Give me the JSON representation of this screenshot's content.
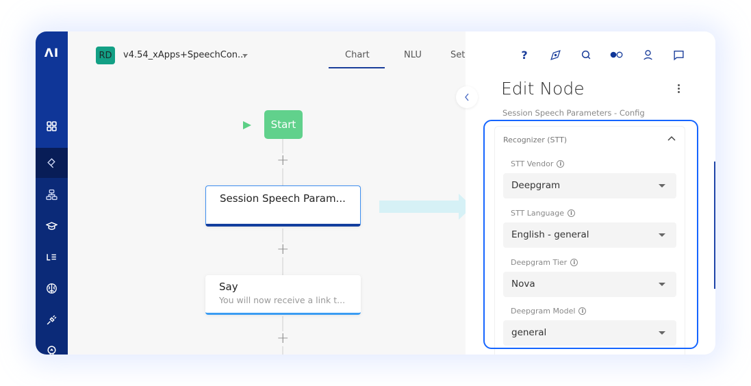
{
  "sidebar": {
    "logo": "ΛI",
    "items": [
      {
        "icon": "grid-icon",
        "label": "Dashboard"
      },
      {
        "icon": "paint-roller-icon",
        "label": "Build",
        "active": true
      },
      {
        "icon": "sitemap-icon",
        "label": "Flows"
      },
      {
        "icon": "graduation-cap-icon",
        "label": "Training"
      },
      {
        "icon": "lexicon-icon",
        "label": "Lexicon"
      },
      {
        "icon": "brain-icon",
        "label": "AI"
      },
      {
        "icon": "plug-icon",
        "label": "Integrations"
      },
      {
        "icon": "lightbulb-icon",
        "label": "Insights"
      }
    ]
  },
  "header": {
    "avatar_initials": "RD",
    "project_name": "v4.54_xApps+SpeechCon...",
    "tabs": [
      {
        "label": "Chart",
        "active": true
      },
      {
        "label": "NLU",
        "active": false
      },
      {
        "label": "Set",
        "active": false
      }
    ]
  },
  "flow": {
    "start_label": "Start",
    "nodes": [
      {
        "title": "Session Speech Param...",
        "subtitle": "",
        "selected": true
      },
      {
        "title": "Say",
        "subtitle": "You will now receive a link t...",
        "selected": false
      }
    ],
    "add_symbol": "+"
  },
  "panel": {
    "top_icons": [
      "help-icon",
      "compass-icon",
      "search-icon",
      "toggle-icon",
      "user-icon",
      "chat-icon"
    ],
    "help_glyph": "?",
    "title": "Edit Node",
    "subtitle": "Session Speech Parameters - Config",
    "section": {
      "title": "Recognizer (STT)",
      "expanded": true,
      "fields": [
        {
          "label": "STT Vendor",
          "value": "Deepgram"
        },
        {
          "label": "STT Language",
          "value": "English - general"
        },
        {
          "label": "Deepgram Tier",
          "value": "Nova"
        },
        {
          "label": "Deepgram Model",
          "value": "general"
        }
      ]
    },
    "info_glyph": "i"
  },
  "colors": {
    "sidebar": "#0f3698",
    "sidebar_active": "#081d57",
    "start_node": "#61d18c",
    "highlight": "#1565ff",
    "say_accent": "#3a9cf2",
    "selected_accent": "#133e9e",
    "avatar": "#13a085"
  }
}
